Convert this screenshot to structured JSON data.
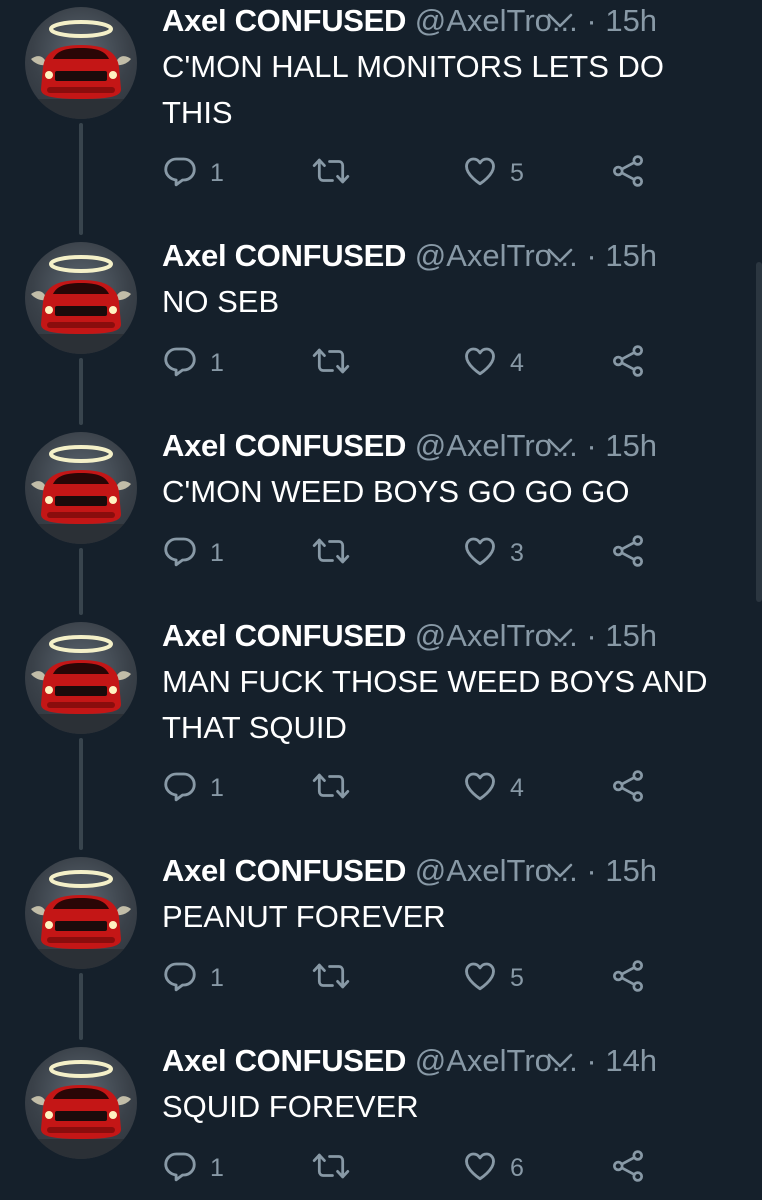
{
  "tweets": [
    {
      "name": "Axel CONFUSED",
      "handle": "@AxelTro...",
      "dot": "·",
      "time": "15h",
      "text": "C'MON HALL MONITORS LETS DO THIS",
      "replies": "1",
      "likes": "5"
    },
    {
      "name": "Axel CONFUSED",
      "handle": "@AxelTro...",
      "dot": "·",
      "time": "15h",
      "text": "NO SEB",
      "replies": "1",
      "likes": "4"
    },
    {
      "name": "Axel CONFUSED",
      "handle": "@AxelTro...",
      "dot": "·",
      "time": "15h",
      "text": "C'MON WEED BOYS GO GO GO",
      "replies": "1",
      "likes": "3"
    },
    {
      "name": "Axel CONFUSED",
      "handle": "@AxelTro...",
      "dot": "·",
      "time": "15h",
      "text": "MAN FUCK THOSE WEED BOYS AND THAT SQUID",
      "replies": "1",
      "likes": "4"
    },
    {
      "name": "Axel CONFUSED",
      "handle": "@AxelTro...",
      "dot": "·",
      "time": "15h",
      "text": "PEANUT FOREVER",
      "replies": "1",
      "likes": "5"
    },
    {
      "name": "Axel CONFUSED",
      "handle": "@AxelTro...",
      "dot": "·",
      "time": "14h",
      "text": "SQUID FOREVER",
      "replies": "1",
      "likes": "6"
    }
  ],
  "icons": {
    "reply": "reply-icon",
    "retweet": "retweet-icon",
    "like": "heart-icon",
    "share": "share-icon",
    "menu": "chevron-down-icon",
    "avatar": "avatar-car-halo"
  },
  "colors": {
    "background": "#15202b",
    "text": "#ffffff",
    "secondary": "#8899a6",
    "thread_line": "#38444d"
  }
}
